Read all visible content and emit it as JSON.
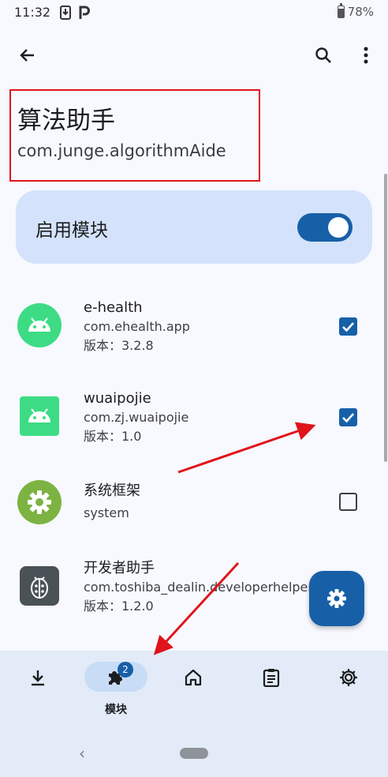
{
  "status_bar": {
    "time": "11:32",
    "battery": "78%"
  },
  "app_bar": {
    "back_icon": "arrow-back-icon",
    "search_icon": "search-icon",
    "more_icon": "more-vert-icon"
  },
  "header": {
    "app_name": "算法助手",
    "package_name": "com.junge.algorithmAide"
  },
  "enable_card": {
    "label": "启用模块",
    "enabled": true
  },
  "scope_list": [
    {
      "title": "e-health",
      "package": "com.ehealth.app",
      "version": "版本：3.2.8",
      "checked": true,
      "icon": "android-icon"
    },
    {
      "title": "wuaipojie",
      "package": "com.zj.wuaipojie",
      "version": "版本：1.0",
      "checked": true,
      "icon": "android-icon"
    },
    {
      "title": "系统框架",
      "package": "system",
      "version": "",
      "checked": false,
      "icon": "gear-icon"
    },
    {
      "title": "开发者助手",
      "package": "com.toshiba_dealin.developerhelper",
      "version": "版本：1.2.0",
      "checked": false,
      "icon": "ladybug-icon"
    }
  ],
  "fab": {
    "icon": "gear-icon"
  },
  "bottom_nav": {
    "items": [
      {
        "icon": "download-icon",
        "label": ""
      },
      {
        "icon": "puzzle-icon",
        "label": "模块",
        "badge": "2",
        "active": true
      },
      {
        "icon": "home-icon",
        "label": ""
      },
      {
        "icon": "clipboard-icon",
        "label": ""
      },
      {
        "icon": "settings-icon",
        "label": ""
      }
    ]
  },
  "colors": {
    "accent": "#1760a8",
    "card": "#d4e3fb",
    "annotation": "#e0141b",
    "nav_bg": "#e2ebf7"
  }
}
